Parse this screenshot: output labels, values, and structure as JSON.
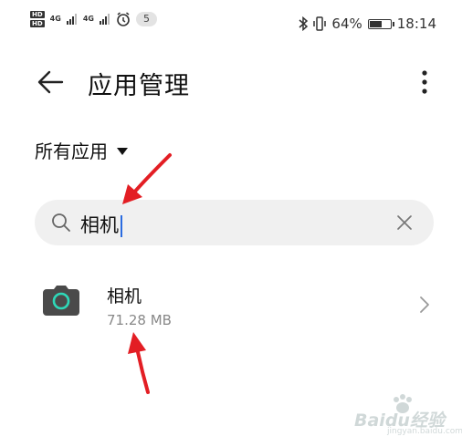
{
  "status_bar": {
    "hd1": "HD",
    "hd2": "HD",
    "signal1": "4G",
    "signal2": "4G",
    "notification_count": "5",
    "battery_percent": "64%",
    "battery_level": 0.64,
    "time": "18:14",
    "icons": [
      "bluetooth-icon",
      "vibrate-icon",
      "alarm-icon",
      "battery-icon"
    ]
  },
  "header": {
    "title": "应用管理",
    "back_icon": "arrow-left-icon",
    "menu_icon": "more-vertical-icon"
  },
  "filter": {
    "selected": "所有应用",
    "icon": "dropdown-triangle-icon"
  },
  "search": {
    "value": "相机",
    "icon": "search-icon",
    "clear_icon": "close-icon"
  },
  "apps": [
    {
      "name": "相机",
      "size": "71.28 MB",
      "icon": "camera-icon"
    }
  ],
  "watermark": {
    "text": "Baidu经验",
    "sub": "jingyan.baidu.com"
  },
  "colors": {
    "annotation_arrow": "#e31e24",
    "caret": "#2a6be0",
    "camera_ring": "#2ed8b8"
  }
}
